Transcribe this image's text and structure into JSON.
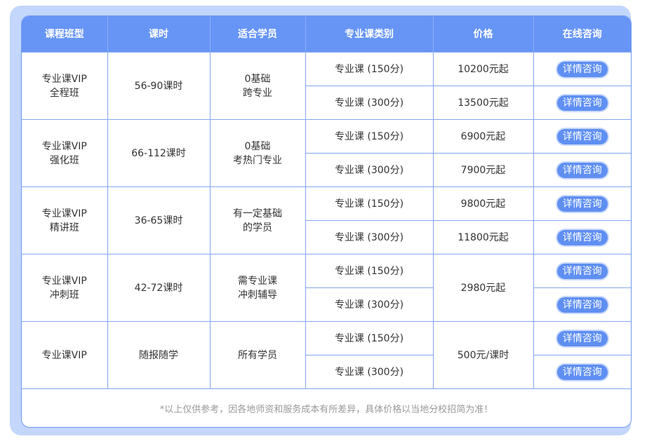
{
  "headers": [
    "课程班型",
    "课时",
    "适合学员",
    "专业课类别",
    "价格",
    "在线咨询"
  ],
  "groups": [
    {
      "type_lines": [
        "专业课VIP",
        "全程班"
      ],
      "hours": "56-90课时",
      "students_lines": [
        "0基础",
        "跨专业"
      ],
      "rows": [
        {
          "category": "专业课 (150分)",
          "price": "10200元起"
        },
        {
          "category": "专业课 (300分)",
          "price": "13500元起"
        }
      ]
    },
    {
      "type_lines": [
        "专业课VIP",
        "强化班"
      ],
      "hours": "66-112课时",
      "students_lines": [
        "0基础",
        "考热门专业"
      ],
      "rows": [
        {
          "category": "专业课 (150分)",
          "price": "6900元起"
        },
        {
          "category": "专业课 (300分)",
          "price": "7900元起"
        }
      ]
    },
    {
      "type_lines": [
        "专业课VIP",
        "精讲班"
      ],
      "hours": "36-65课时",
      "students_lines": [
        "有一定基础",
        "的学员"
      ],
      "rows": [
        {
          "category": "专业课 (150分)",
          "price": "9800元起"
        },
        {
          "category": "专业课 (300分)",
          "price": "11800元起"
        }
      ]
    },
    {
      "type_lines": [
        "专业课VIP",
        "冲刺班"
      ],
      "hours": "42-72课时",
      "students_lines": [
        "需专业课",
        "冲刺辅导"
      ],
      "shared_price": "2980元起",
      "rows": [
        {
          "category": "专业课 (150分)"
        },
        {
          "category": "专业课 (300分)"
        }
      ]
    },
    {
      "type_lines": [
        "专业课VIP"
      ],
      "hours": "随报随学",
      "students_lines": [
        "所有学员"
      ],
      "shared_price": "500元/课时",
      "rows": [
        {
          "category": "专业课 (150分)"
        },
        {
          "category": "专业课 (300分)"
        }
      ]
    }
  ],
  "consult_label": "详情咨询",
  "note": "*以上仅供参考，因各地师资和服务成本有所差异，具体价格以当地分校招简为准！",
  "colors": {
    "header_bg": "#6795f6",
    "border": "#82a5ee",
    "button": "#5f8ff2",
    "frame": "#c3d6fb"
  }
}
